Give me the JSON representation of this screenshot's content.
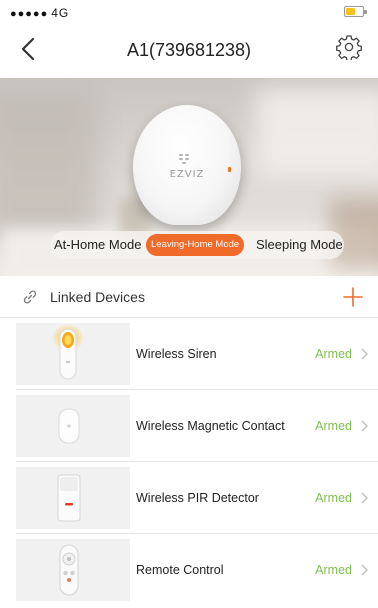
{
  "status_bar": {
    "signal_dots": "●●●●●",
    "network": "4G"
  },
  "header": {
    "title": "A1(739681238)"
  },
  "hub": {
    "brand": "EZVIZ"
  },
  "modes": {
    "at_home": "At-Home Mode",
    "leaving_home": "Leaving-Home Mode",
    "sleeping": "Sleeping Mode",
    "selected": "Leaving-Home Mode"
  },
  "linked_devices": {
    "label": "Linked Devices"
  },
  "devices": [
    {
      "name": "Wireless Siren",
      "status": "Armed",
      "icon": "siren-icon"
    },
    {
      "name": "Wireless Magnetic Contact",
      "status": "Armed",
      "icon": "magnetic-contact-icon"
    },
    {
      "name": "Wireless PIR Detector",
      "status": "Armed",
      "icon": "pir-detector-icon"
    },
    {
      "name": "Remote Control",
      "status": "Armed",
      "icon": "remote-control-icon"
    }
  ],
  "colors": {
    "accent": "#f06a2a",
    "armed": "#7ec24a",
    "battery": "#f6c21c"
  }
}
